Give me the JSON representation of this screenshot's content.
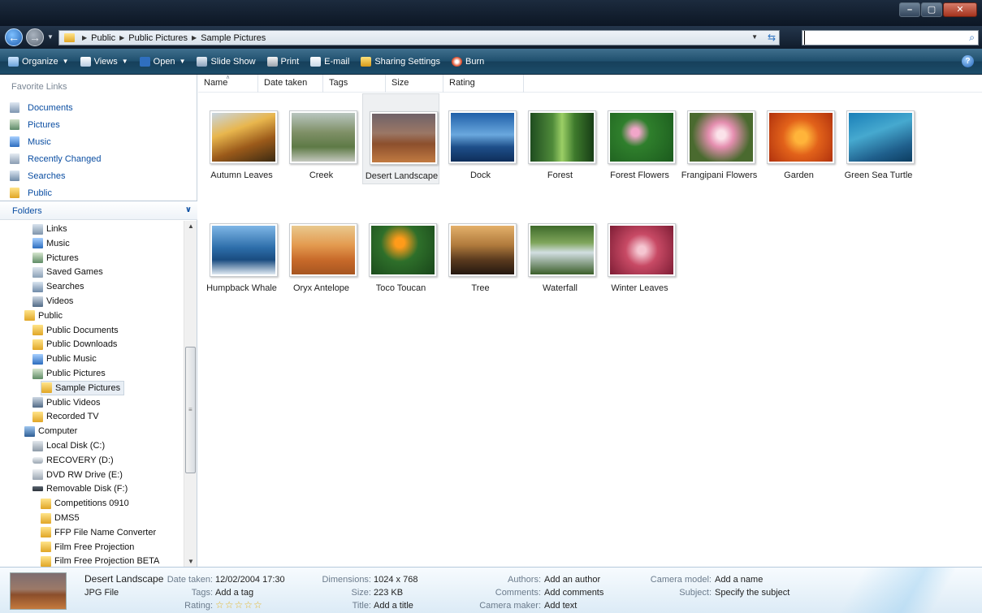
{
  "window": {
    "minimize": "–",
    "maximize": "▢",
    "close": "✕"
  },
  "address": {
    "crumbs": [
      "Public",
      "Public Pictures",
      "Sample Pictures"
    ],
    "search_value": ""
  },
  "toolbar": {
    "organize": "Organize",
    "views": "Views",
    "open": "Open",
    "slideshow": "Slide Show",
    "print": "Print",
    "email": "E-mail",
    "sharing": "Sharing Settings",
    "burn": "Burn",
    "help": "?"
  },
  "nav": {
    "favorites_header": "Favorite Links",
    "favorites": [
      "Documents",
      "Pictures",
      "Music",
      "Recently Changed",
      "Searches",
      "Public"
    ],
    "folders_header": "Folders",
    "tree": [
      {
        "label": "Links",
        "icon": "links-icon"
      },
      {
        "label": "Music",
        "icon": "music-folder-icon"
      },
      {
        "label": "Pictures",
        "icon": "pictures-folder-icon"
      },
      {
        "label": "Saved Games",
        "icon": "saved-games-icon"
      },
      {
        "label": "Searches",
        "icon": "searches-icon"
      },
      {
        "label": "Videos",
        "icon": "videos-folder-icon"
      },
      {
        "label": "Public",
        "icon": "folder-icon"
      },
      {
        "label": "Public Documents",
        "icon": "folder-icon"
      },
      {
        "label": "Public Downloads",
        "icon": "folder-icon"
      },
      {
        "label": "Public Music",
        "icon": "music-folder-icon"
      },
      {
        "label": "Public Pictures",
        "icon": "pictures-folder-icon"
      },
      {
        "label": "Sample Pictures",
        "icon": "folder-icon"
      },
      {
        "label": "Public Videos",
        "icon": "videos-folder-icon"
      },
      {
        "label": "Recorded TV",
        "icon": "folder-icon"
      },
      {
        "label": "Computer",
        "icon": "computer-icon"
      },
      {
        "label": "Local Disk (C:)",
        "icon": "local-disk-icon"
      },
      {
        "label": "RECOVERY (D:)",
        "icon": "drive-icon"
      },
      {
        "label": "DVD RW Drive (E:)",
        "icon": "dvd-drive-icon"
      },
      {
        "label": "Removable Disk (F:)",
        "icon": "removable-disk-icon"
      },
      {
        "label": "Competitions 0910",
        "icon": "folder-icon"
      },
      {
        "label": "DMS5",
        "icon": "folder-icon"
      },
      {
        "label": "FFP File Name Converter",
        "icon": "folder-icon"
      },
      {
        "label": "Film Free Projection",
        "icon": "folder-icon"
      },
      {
        "label": "Film Free Projection BETA",
        "icon": "folder-icon"
      }
    ]
  },
  "columns": [
    "Name",
    "Date taken",
    "Tags",
    "Size",
    "Rating"
  ],
  "thumbnails": [
    "Autumn Leaves",
    "Creek",
    "Desert Landscape",
    "Dock",
    "Forest",
    "Forest Flowers",
    "Frangipani Flowers",
    "Garden",
    "Green Sea Turtle",
    "Humpback Whale",
    "Oryx Antelope",
    "Toco Toucan",
    "Tree",
    "Waterfall",
    "Winter Leaves"
  ],
  "selected_item": "Desert Landscape",
  "details": {
    "name": "Desert Landscape",
    "type": "JPG File",
    "date_taken_label": "Date taken:",
    "date_taken": "12/02/2004 17:30",
    "tags_label": "Tags:",
    "tags": "Add a tag",
    "rating_label": "Rating:",
    "rating_stars": "☆☆☆☆☆",
    "dimensions_label": "Dimensions:",
    "dimensions": "1024 x 768",
    "size_label": "Size:",
    "size": "223 KB",
    "title_label": "Title:",
    "title": "Add a title",
    "authors_label": "Authors:",
    "authors": "Add an author",
    "comments_label": "Comments:",
    "comments": "Add comments",
    "camera_maker_label": "Camera maker:",
    "camera_maker": "Add text",
    "camera_model_label": "Camera model:",
    "camera_model": "Add a name",
    "subject_label": "Subject:",
    "subject": "Specify the subject"
  },
  "colors": {
    "link": "#0b4ea2",
    "toolbar": "#1f4f6d",
    "details_bg": "#dcebf6"
  }
}
